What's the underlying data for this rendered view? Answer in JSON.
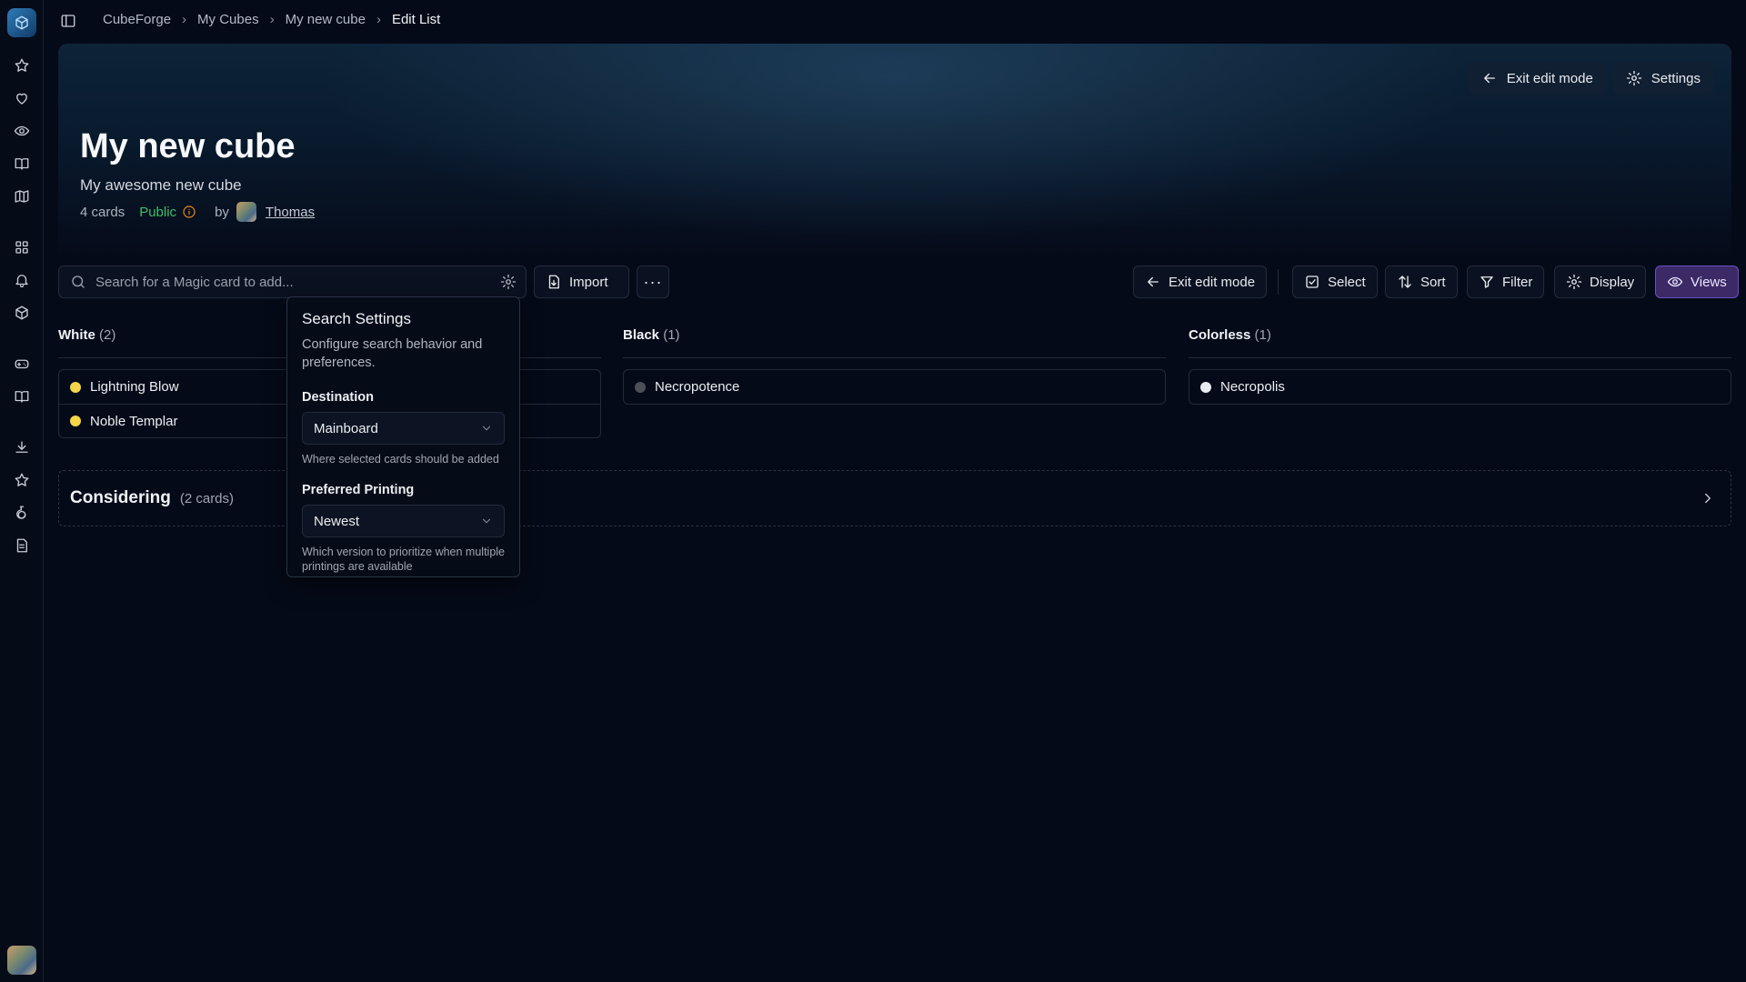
{
  "breadcrumb": [
    "CubeForge",
    "My Cubes",
    "My new cube",
    "Edit List"
  ],
  "hero": {
    "exit_edit_label": "Exit edit mode",
    "settings_label": "Settings",
    "title": "My new cube",
    "description": "My awesome new cube",
    "card_count": "4 cards",
    "visibility": "Public",
    "by_label": "by",
    "owner": "Thomas"
  },
  "toolbar": {
    "search_placeholder": "Search for a Magic card to add...",
    "import_label": "Import",
    "exit_edit_label": "Exit edit mode",
    "select_label": "Select",
    "sort_label": "Sort",
    "filter_label": "Filter",
    "display_label": "Display",
    "views_label": "Views"
  },
  "columns": [
    {
      "name": "White",
      "count": "(2)",
      "cards": [
        {
          "name": "Lightning Blow",
          "dot_color": "#f5d64a"
        },
        {
          "name": "Noble Templar",
          "dot_color": "#f5d64a"
        }
      ]
    },
    {
      "name": "Black",
      "count": "(1)",
      "cards": [
        {
          "name": "Necropotence",
          "dot_color": "#4b4f58"
        }
      ]
    },
    {
      "name": "Colorless",
      "count": "(1)",
      "cards": [
        {
          "name": "Necropolis",
          "dot_color": "#e9ebef"
        }
      ]
    }
  ],
  "considering": {
    "title": "Considering",
    "count": "(2 cards)"
  },
  "search_settings": {
    "title": "Search Settings",
    "description": "Configure search behavior and preferences.",
    "destination_label": "Destination",
    "destination_value": "Mainboard",
    "destination_help": "Where selected cards should be added",
    "printing_label": "Preferred Printing",
    "printing_value": "Newest",
    "printing_help": "Which version to prioritize when multiple printings are available"
  },
  "colors": {
    "accent": "#6a4fc4",
    "public": "#3fbf6a",
    "info": "#e8871f"
  }
}
